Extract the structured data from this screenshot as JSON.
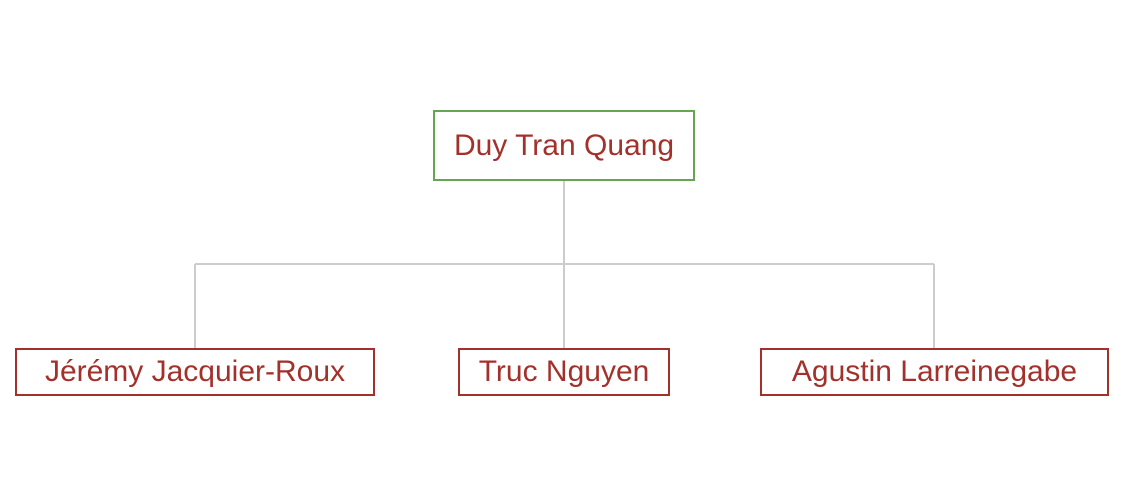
{
  "org_chart": {
    "root": {
      "name": "Duy Tran Quang",
      "border_color": "#68a553"
    },
    "children": [
      {
        "name": "Jérémy Jacquier-Roux"
      },
      {
        "name": "Truc Nguyen"
      },
      {
        "name": "Agustin Larreinegabe"
      }
    ],
    "colors": {
      "text": "#a3312b",
      "child_border": "#a3312b",
      "connector": "#cccccc"
    }
  }
}
